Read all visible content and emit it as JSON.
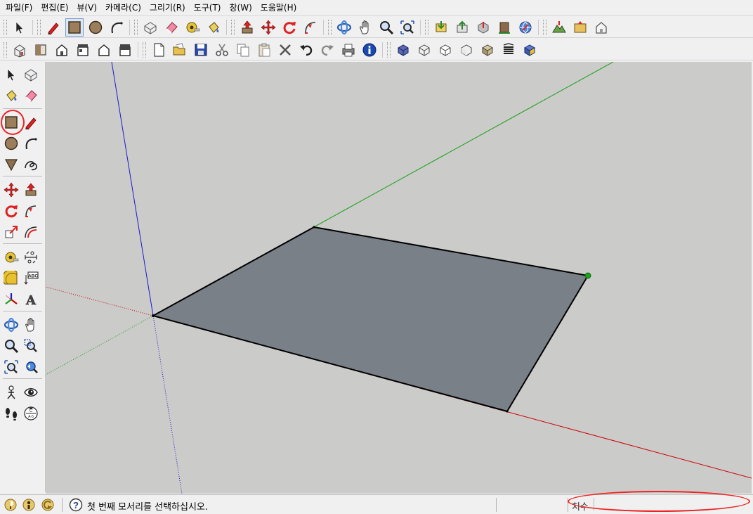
{
  "menu": {
    "items": [
      "파일(F)",
      "편집(E)",
      "뷰(V)",
      "카메라(C)",
      "그리기(R)",
      "도구(T)",
      "창(W)",
      "도움말(H)"
    ]
  },
  "toolbars": {
    "row1": [
      [
        "select-icon"
      ],
      [
        "pencil-icon",
        "rectangle-icon",
        "circle-icon",
        "arc-icon"
      ],
      [
        "make-component-icon",
        "eraser-icon",
        "tape-measure-icon",
        "paint-bucket-icon"
      ],
      [
        "push-pull-icon",
        "move-icon",
        "rotate-icon",
        "follow-me-icon"
      ],
      [
        "orbit-icon",
        "pan-icon",
        "zoom-icon",
        "zoom-extents-icon"
      ],
      [
        "get-models-icon",
        "share-model-icon",
        "share-component-icon",
        "place-model-icon",
        "get-current-view-icon"
      ],
      [
        "toggle-terrain-icon",
        "get-photo-texture-icon",
        "add-building-icon"
      ]
    ],
    "row2": [
      [
        "iso-view-icon",
        "top-view-icon",
        "front-view-icon",
        "right-view-icon",
        "back-view-icon",
        "left-view-icon"
      ],
      [
        "new-icon",
        "open-icon",
        "save-icon",
        "cut-icon",
        "copy-icon",
        "paste-icon",
        "delete-icon",
        "undo-icon",
        "redo-icon",
        "print-icon",
        "model-info-icon"
      ],
      [
        "xray-icon",
        "wireframe-icon",
        "hidden-line-icon",
        "shaded-icon",
        "shaded-textures-icon",
        "monochrome-icon",
        "shadows-icon"
      ]
    ]
  },
  "left_toolbar": [
    [
      "select-icon",
      "make-component-icon"
    ],
    [
      "paint-bucket-icon",
      "eraser-icon"
    ],
    [
      "rectangle-icon",
      "pencil-icon"
    ],
    [
      "circle-icon",
      "arc-icon"
    ],
    [
      "polygon-icon",
      "freehand-icon"
    ],
    [
      "move-icon",
      "push-pull-icon"
    ],
    [
      "rotate-icon",
      "follow-me-icon"
    ],
    [
      "scale-icon",
      "offset-icon"
    ],
    [
      "tape-measure-icon",
      "dimension-icon"
    ],
    [
      "protractor-icon",
      "text-icon"
    ],
    [
      "axes-icon",
      "3d-text-icon"
    ],
    [
      "orbit-icon",
      "pan-icon"
    ],
    [
      "zoom-icon",
      "zoom-window-icon"
    ],
    [
      "zoom-extents-icon",
      "previous-view-icon"
    ],
    [
      "position-camera-icon",
      "look-around-icon"
    ],
    [
      "walk-icon",
      "section-plane-icon"
    ]
  ],
  "colors": {
    "face": "#7a8087",
    "red_axis": "#cc0000",
    "green_axis": "#1aa01a",
    "blue_axis": "#1a1acc",
    "annotation": "#e02020"
  },
  "status": {
    "message": "첫 번째 모서리를 선택하십시오.",
    "vcb_label": "치수",
    "vcb_value": ""
  }
}
